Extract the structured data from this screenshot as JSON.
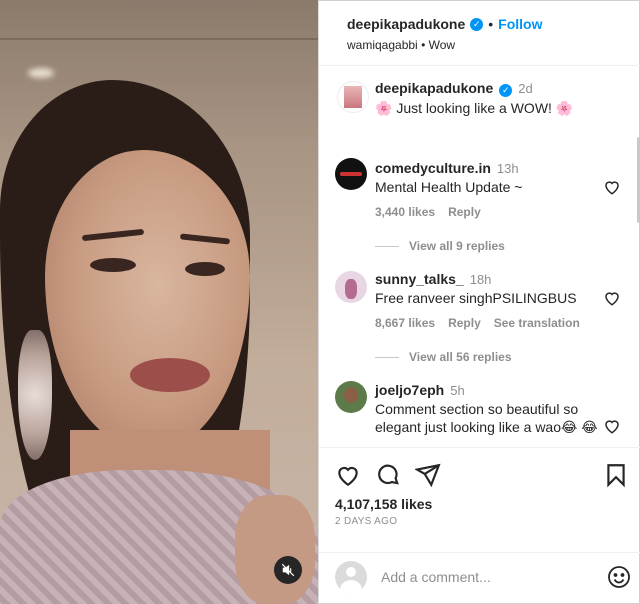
{
  "header": {
    "username": "deepikapadukone",
    "separator": "•",
    "follow_label": "Follow",
    "audio_user": "wamiqagabbi",
    "audio_label": "Wow"
  },
  "caption": {
    "username": "deepikapadukone",
    "time": "2d",
    "text": "🌸 Just looking like a WOW! 🌸"
  },
  "comments": [
    {
      "username": "comedyculture.in",
      "time": "13h",
      "text": "Mental Health Update ~",
      "likes": "3,440 likes",
      "reply_label": "Reply",
      "view_replies": "View all 9 replies"
    },
    {
      "username": "sunny_talks_",
      "time": "18h",
      "text": "Free ranveer singhPSILINGBUS",
      "likes": "8,667 likes",
      "reply_label": "Reply",
      "translation_label": "See translation",
      "view_replies": "View all 56 replies"
    },
    {
      "username": "joeljo7eph",
      "time": "5h",
      "text": "Comment section so beautiful so elegant just looking like a wao😂 😂"
    }
  ],
  "post": {
    "likes": "4,107,158 likes",
    "date": "2 DAYS AGO"
  },
  "add_comment": {
    "placeholder": "Add a comment..."
  },
  "icons": {
    "verified": "verified-badge-icon",
    "heart": "heart-icon",
    "comment": "comment-icon",
    "share": "share-icon",
    "save": "bookmark-icon",
    "mute": "muted-speaker-icon",
    "emoji": "emoji-icon"
  },
  "colors": {
    "accent": "#0095f6",
    "text": "#262626",
    "secondary": "#8e8e8e"
  }
}
